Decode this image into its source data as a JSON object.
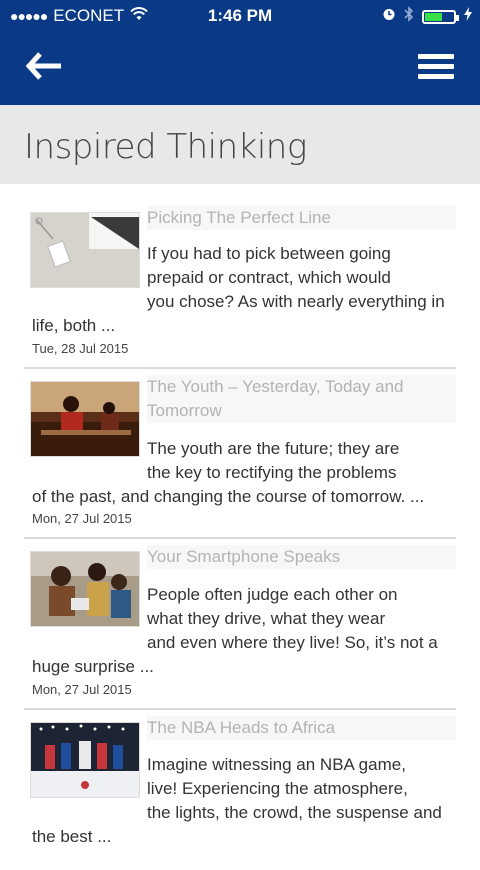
{
  "status": {
    "carrier": "ECONET",
    "time": "1:46 PM"
  },
  "header": {
    "title": "Inspired Thinking"
  },
  "articles": [
    {
      "title": "Picking The Perfect Line",
      "lines": [
        "If you had to pick between going",
        "prepaid or contract, which would",
        "you chose? As with nearly everything in"
      ],
      "wrap": "life, both ...",
      "date": "Tue, 28 Jul 2015"
    },
    {
      "title_lines": [
        "The Youth – Yesterday, Today and",
        "Tomorrow"
      ],
      "lines": [
        "The youth are the future; they are",
        "the key to rectifying the problems"
      ],
      "wrap": "of the past, and changing the course of tomorrow. ...",
      "date": "Mon, 27 Jul 2015"
    },
    {
      "title": "Your Smartphone Speaks",
      "lines": [
        "People often judge each other on",
        "what they drive, what they wear",
        "and even where they live! So, it’s not a"
      ],
      "wrap": "huge surprise ...",
      "date": "Mon, 27 Jul 2015"
    },
    {
      "title": "The NBA Heads to Africa",
      "lines": [
        "Imagine witnessing an NBA game,",
        "live! Experiencing the atmosphere,",
        "the lights, the crowd, the suspense and"
      ],
      "wrap": "the best ..."
    }
  ]
}
